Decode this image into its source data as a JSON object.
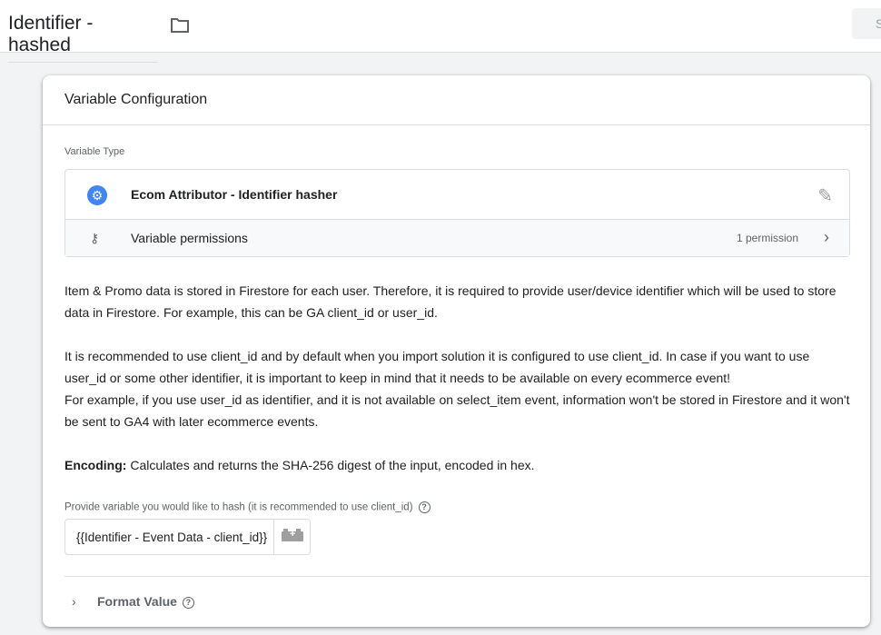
{
  "header": {
    "title": "Identifier - hashed",
    "save_label": "S"
  },
  "card": {
    "title": "Variable Configuration",
    "variable_type_label": "Variable Type",
    "variable_name": "Ecom Attributor - Identifier hasher",
    "permissions_label": "Variable permissions",
    "permissions_count": "1 permission",
    "description": [
      "Item & Promo data is stored in Firestore for each user. Therefore, it is required to provide user/device identifier which will be used to store data in Firestore. For example, this can be GA client_id or user_id.",
      "It is recommended to use client_id and by default when you import solution it is configured to use client_id. In case if you want to use user_id or some other identifier, it is important to keep in mind that it needs to be available on every ecommerce event!",
      "For example, if you use user_id as identifier, and it is not available on select_item event, information won't be stored in Firestore and it won't be sent to GA4 with later ecommerce events."
    ],
    "encoding_label": "Encoding:",
    "encoding_text": " Calculates and returns the SHA-256 digest of the input, encoded in hex.",
    "hash_field_label": "Provide variable you would like to hash (it is recommended to use client_id)",
    "hash_field_value": "{{Identifier - Event Data - client_id}}",
    "format_value_label": "Format Value"
  },
  "colors": {
    "accent": "#4285f4"
  }
}
